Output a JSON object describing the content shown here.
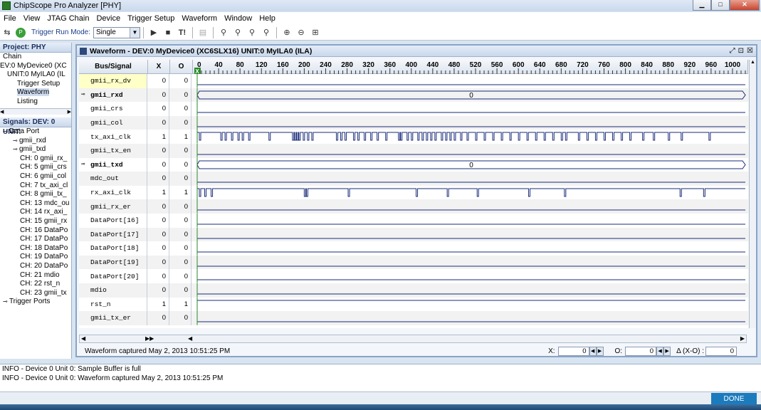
{
  "app": {
    "title": "ChipScope Pro Analyzer [PHY]"
  },
  "menu": [
    "File",
    "View",
    "JTAG Chain",
    "Device",
    "Trigger Setup",
    "Waveform",
    "Window",
    "Help"
  ],
  "toolbar": {
    "trigger_run_mode_label": "Trigger Run Mode:",
    "trigger_run_mode_value": "Single",
    "trigger_now_label": "T!"
  },
  "project": {
    "header": "Project: PHY",
    "items": [
      "Chain",
      "EV:0 MyDevice0 (XC",
      "UNIT:0 MyILA0 (IL",
      "Trigger Setup",
      "Waveform",
      "Listing"
    ]
  },
  "signals_panel": {
    "header": "Signals: DEV: 0 UNIT:",
    "items": [
      "Data Port",
      "gmii_rxd",
      "gmii_txd",
      "CH: 0 gmii_rx_",
      "CH: 5 gmii_crs",
      "CH: 6 gmii_col",
      "CH: 7 tx_axi_cl",
      "CH: 8 gmii_tx_",
      "CH: 13 mdc_ou",
      "CH: 14 rx_axi_",
      "CH: 15 gmii_rx",
      "CH: 16 DataPo",
      "CH: 17 DataPo",
      "CH: 18 DataPo",
      "CH: 19 DataPo",
      "CH: 20 DataPo",
      "CH: 21 mdio",
      "CH: 22 rst_n",
      "CH: 23 gmii_tx",
      "Trigger Ports"
    ]
  },
  "waveform": {
    "title": "Waveform - DEV:0 MyDevice0 (XC6SLX16) UNIT:0 MyILA0 (ILA)",
    "columns": {
      "name": "Bus/Signal",
      "x": "X",
      "o": "O"
    },
    "marker_x": "X",
    "timeline": {
      "min": 0,
      "max": 1024,
      "labels": [
        0,
        40,
        80,
        120,
        160,
        200,
        240,
        280,
        320,
        360,
        400,
        440,
        480,
        520,
        560,
        600,
        640,
        680,
        720,
        760,
        800,
        840,
        880,
        920,
        960,
        1000
      ]
    },
    "signals": [
      {
        "name": "gmii_rx_dv",
        "x": "0",
        "o": "0",
        "type": "bit",
        "level": 0,
        "pulses": [],
        "highlight": true
      },
      {
        "name": "gmii_rxd",
        "x": "0",
        "o": "0",
        "type": "bus",
        "bus_value": "0",
        "expandable": true
      },
      {
        "name": "gmii_crs",
        "x": "0",
        "o": "0",
        "type": "bit",
        "level": 0,
        "pulses": []
      },
      {
        "name": "gmii_col",
        "x": "0",
        "o": "0",
        "type": "bit",
        "level": 0,
        "pulses": []
      },
      {
        "name": "tx_axi_clk",
        "x": "1",
        "o": "1",
        "type": "bit",
        "level": 1,
        "pulses": [
          4,
          44,
          52,
          64,
          76,
          84,
          96,
          134,
          178,
          182,
          186,
          190,
          198,
          206,
          214,
          260,
          268,
          276,
          292,
          300,
          312,
          324,
          336,
          352,
          376,
          380,
          392,
          400,
          412,
          420,
          428,
          436,
          444,
          456,
          464,
          472,
          480,
          492,
          504,
          520,
          536,
          552,
          568,
          584,
          600,
          616,
          632,
          648,
          664,
          680,
          688,
          712,
          728,
          744,
          760,
          776,
          792,
          808,
          832,
          852,
          880,
          904,
          956
        ]
      },
      {
        "name": "gmii_tx_en",
        "x": "0",
        "o": "0",
        "type": "bit",
        "level": 0,
        "pulses": []
      },
      {
        "name": "gmii_txd",
        "x": "0",
        "o": "0",
        "type": "bus",
        "bus_value": "0",
        "expandable": true
      },
      {
        "name": "mdc_out",
        "x": "0",
        "o": "0",
        "type": "bit",
        "level": 0,
        "pulses": []
      },
      {
        "name": "rx_axi_clk",
        "x": "1",
        "o": "1",
        "type": "bit",
        "level": 1,
        "pulses": [
          4,
          14,
          26,
          200,
          204,
          282,
          409,
          467,
          523,
          619,
          686,
          902,
          946
        ]
      },
      {
        "name": "gmii_rx_er",
        "x": "0",
        "o": "0",
        "type": "bit",
        "level": 0,
        "pulses": []
      },
      {
        "name": "DataPort[16]",
        "x": "0",
        "o": "0",
        "type": "bit",
        "level": 0,
        "pulses": []
      },
      {
        "name": "DataPort[17]",
        "x": "0",
        "o": "0",
        "type": "bit",
        "level": 0,
        "pulses": []
      },
      {
        "name": "DataPort[18]",
        "x": "0",
        "o": "0",
        "type": "bit",
        "level": 0,
        "pulses": []
      },
      {
        "name": "DataPort[19]",
        "x": "0",
        "o": "0",
        "type": "bit",
        "level": 0,
        "pulses": []
      },
      {
        "name": "DataPort[20]",
        "x": "0",
        "o": "0",
        "type": "bit",
        "level": 0,
        "pulses": []
      },
      {
        "name": "mdio",
        "x": "0",
        "o": "0",
        "type": "bit",
        "level": 0,
        "pulses": []
      },
      {
        "name": "rst_n",
        "x": "1",
        "o": "1",
        "type": "bit",
        "level": 1,
        "pulses": []
      },
      {
        "name": "gmii_tx_er",
        "x": "0",
        "o": "0",
        "type": "bit",
        "level": 0,
        "pulses": []
      }
    ],
    "status": "Waveform captured May 2, 2013 10:51:25 PM",
    "cursor_x_label": "X:",
    "cursor_x_value": "0",
    "cursor_o_label": "O:",
    "cursor_o_value": "0",
    "delta_label": "Δ (X-O) :",
    "delta_value": "0"
  },
  "console": [
    "INFO - Device 0 Unit 0:  Sample Buffer is full",
    "INFO - Device 0 Unit 0:  Waveform captured May 2, 2013 10:51:25 PM"
  ],
  "statusbar": {
    "done": "DONE"
  },
  "colors": {
    "wave": "#1a2c7a",
    "marker": "#2a8a2a",
    "highlight": "#ffffc8"
  }
}
